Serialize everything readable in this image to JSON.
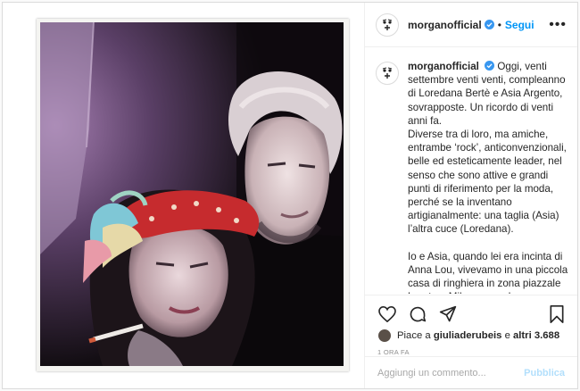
{
  "header": {
    "username": "morganofficial",
    "separator": "•",
    "follow_label": "Segui",
    "more_label": "•••"
  },
  "caption": {
    "username": "morganofficial",
    "paragraphs": [
      "Oggi, venti settembre venti venti, compleanno di Loredana Bertè e Asia Argento, sovrapposte. Un ricordo di venti anni fa.",
      "Diverse tra di loro, ma amiche, entrambe ‘rock’, anticonvenzionali, belle ed esteticamente leader, nel senso che sono attive e grandi punti di riferimento per la moda, perché se la inventano artigianalmente: una taglia (Asia) l’altra cuce (Loredana).",
      "Io e Asia, quando lei era incinta di Anna Lou, vivevamo in una piccola casa di ringhiera in zona piazzale Loreto a Milano, e andavamo a trovare spesso Loredana a casa sua, noi due, perché lei si sentiva sola e sapevo che"
    ]
  },
  "likes": {
    "prefix": "Piace a",
    "user": "giuliaderubeis",
    "middle": "e",
    "others": "altri 3.688"
  },
  "timestamp": "1 ORA FA",
  "comment": {
    "placeholder": "Aggiungi un commento...",
    "publish_label": "Pubblica"
  },
  "colors": {
    "accent": "#0095f6",
    "publish_disabled": "#b2dffc",
    "muted": "#8e8e8e"
  },
  "icons": [
    "verified-badge-icon",
    "heart-icon",
    "comment-icon",
    "share-icon",
    "bookmark-icon",
    "more-options-icon"
  ]
}
